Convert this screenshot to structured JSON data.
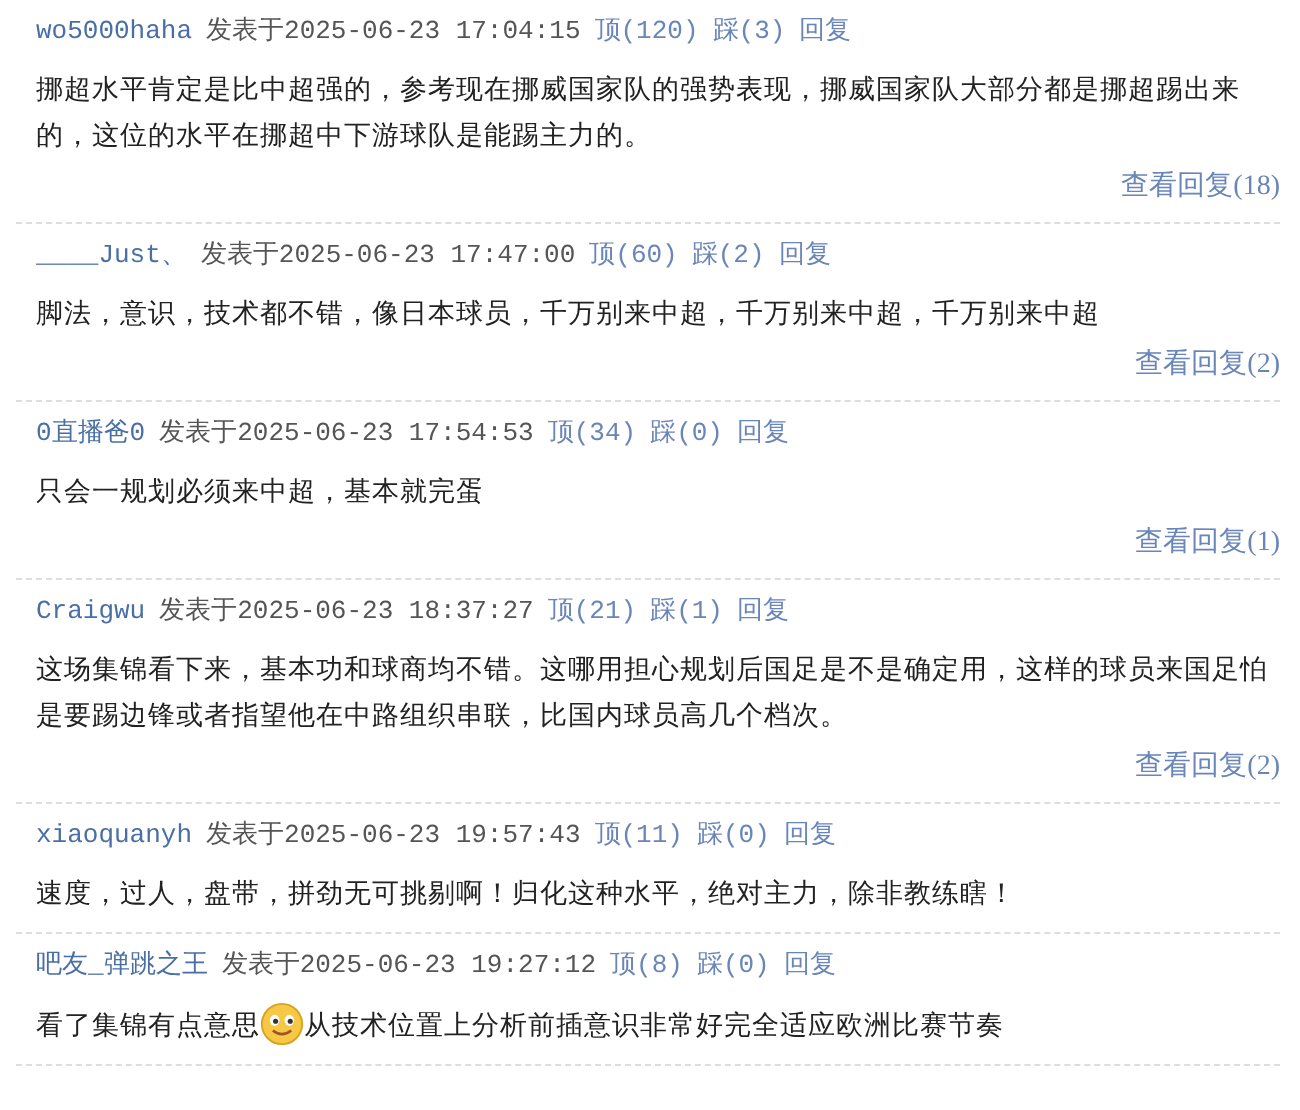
{
  "comments": [
    {
      "user": "wo5000haha",
      "posted": "发表于2025-06-23 17:04:15",
      "up": "顶(120)",
      "down": "踩(3)",
      "reply": "回复",
      "body": [
        {
          "kind": "text",
          "text": "挪超水平肯定是比中超强的，参考现在挪威国家队的强势表现，挪威国家队大部分都是挪超踢出来的，这位的水平在挪超中下游球队是能踢主力的。"
        }
      ],
      "view_replies": "查看回复(18)"
    },
    {
      "user": "____Just、",
      "posted": "发表于2025-06-23 17:47:00",
      "up": "顶(60)",
      "down": "踩(2)",
      "reply": "回复",
      "body": [
        {
          "kind": "text",
          "text": "脚法，意识，技术都不错，像日本球员，千万别来中超，千万别来中超，千万别来中超"
        }
      ],
      "view_replies": "查看回复(2)"
    },
    {
      "user": "0直播爸0",
      "posted": "发表于2025-06-23 17:54:53",
      "up": "顶(34)",
      "down": "踩(0)",
      "reply": "回复",
      "body": [
        {
          "kind": "text",
          "text": "只会一规划必须来中超，基本就完蛋"
        }
      ],
      "view_replies": "查看回复(1)"
    },
    {
      "user": "Craigwu",
      "posted": "发表于2025-06-23 18:37:27",
      "up": "顶(21)",
      "down": "踩(1)",
      "reply": "回复",
      "body": [
        {
          "kind": "text",
          "text": "这场集锦看下来，基本功和球商均不错。这哪用担心规划后国足是不是确定用，这样的球员来国足怕是要踢边锋或者指望他在中路组织串联，比国内球员高几个档次。"
        }
      ],
      "view_replies": "查看回复(2)"
    },
    {
      "user": "xiaoquanyh",
      "posted": "发表于2025-06-23 19:57:43",
      "up": "顶(11)",
      "down": "踩(0)",
      "reply": "回复",
      "body": [
        {
          "kind": "text",
          "text": "速度，过人，盘带，拼劲无可挑剔啊！归化这种水平，绝对主力，除非教练瞎！"
        }
      ]
    },
    {
      "user": "吧友_弹跳之王",
      "posted": "发表于2025-06-23 19:27:12",
      "up": "顶(8)",
      "down": "踩(0)",
      "reply": "回复",
      "body": [
        {
          "kind": "text",
          "text": "看了集锦有点意思"
        },
        {
          "kind": "emoji"
        },
        {
          "kind": "text",
          "text": "从技术位置上分析前插意识非常好完全适应欧洲比赛节奏"
        }
      ]
    }
  ]
}
